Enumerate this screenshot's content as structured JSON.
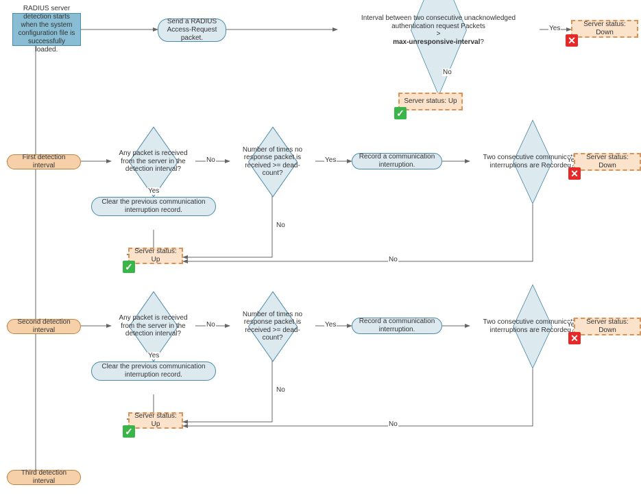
{
  "start": "RADIUS server detection starts when the system configuration file is successfully loaded.",
  "sendPacket": "Send a RADIUS Access-Request packet.",
  "d1a": "Interval between two consecutive unacknowledged authentication request Packets",
  "d1b": ">",
  "d1c": "max-unresponsive-interval",
  "statusDown": "Server status: Down",
  "statusUp": "Server status: Up",
  "firstInterval": "First detection interval",
  "secondInterval": "Second detection interval",
  "thirdInterval": "Third detection interval",
  "dAny": "Any packet is received from the server in the detection interval?",
  "dDead": "Number of times no response packet is received >= dead-count?",
  "record": "Record a communication interruption.",
  "dTwo": "Two consecutive communication interruptions are Recorded?",
  "clear": "Clear the previous communication interruption record.",
  "yes": "Yes",
  "no": "No"
}
